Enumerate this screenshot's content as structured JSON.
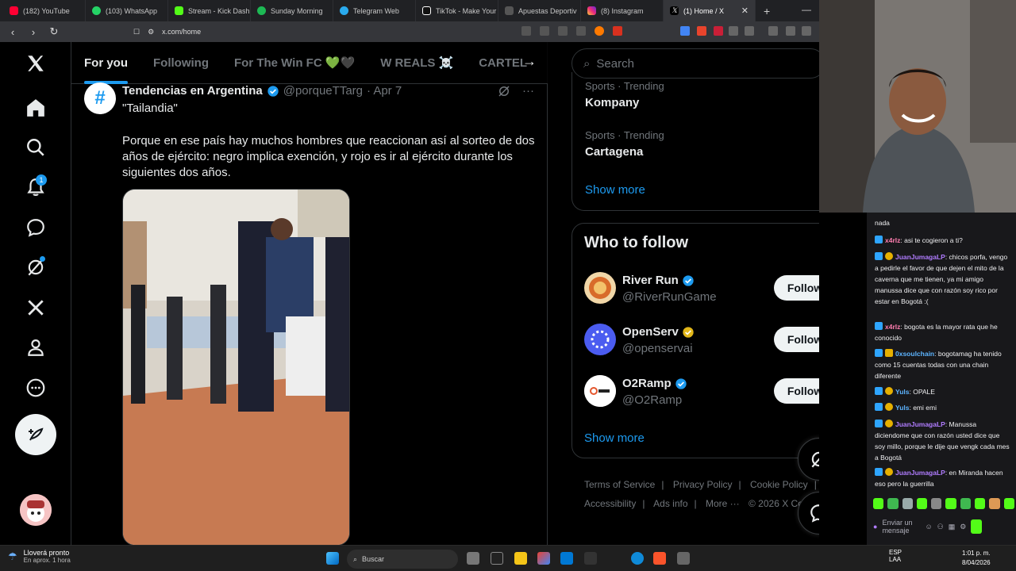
{
  "browser": {
    "tabs": [
      {
        "label": "(182) YouTube",
        "color": "#ff0033"
      },
      {
        "label": "(103) WhatsApp",
        "color": "#25d366"
      },
      {
        "label": "Stream - Kick Dashb",
        "color": "#53fc18"
      },
      {
        "label": "Sunday Morning",
        "color": "#1db954"
      },
      {
        "label": "Telegram Web",
        "color": "#2aabee"
      },
      {
        "label": "TikTok - Make Your",
        "color": "#ffffff"
      },
      {
        "label": "Apuestas Deportiv",
        "color": "#dddddd"
      },
      {
        "label": "(8) Instagram",
        "color": "#e1306c"
      },
      {
        "label": "(1) Home / X",
        "color": "#ffffff"
      }
    ],
    "url": "x.com/home"
  },
  "x": {
    "top_tabs": [
      "For you",
      "Following",
      "For The Win FC 💚🖤",
      "W REALS ☠️",
      "CARTEL"
    ],
    "notifications_badge": "1",
    "tweet": {
      "name": "Tendencias en Argentina",
      "handle": "@porqueTTarg",
      "date": "· Apr 7",
      "subtitle": "\"Tailandia\"",
      "text": "Porque en ese país hay muchos hombres que reaccionan así al sorteo de dos años de ejército: negro implica exención, y rojo es ir al ejército durante los siguientes dos años."
    },
    "search_placeholder": "Search",
    "trends": [
      {
        "category": "Sports · Trending",
        "name": "Kompany"
      },
      {
        "category": "Sports · Trending",
        "name": "Cartagena"
      }
    ],
    "show_more": "Show more",
    "who_to_follow_title": "Who to follow",
    "follow_suggestions": [
      {
        "name": "River Run",
        "handle": "@RiverRunGame",
        "badge_color": "#1d9bf0"
      },
      {
        "name": "OpenServ",
        "handle": "@openservai",
        "badge_color": "#e2b719"
      },
      {
        "name": "O2Ramp",
        "handle": "@O2Ramp",
        "badge_color": "#1d9bf0"
      }
    ],
    "follow_label": "Follow",
    "show_more_2": "Show more",
    "footer_links": [
      "Terms of Service",
      "|",
      "Privacy Policy",
      "|",
      "Cookie Policy",
      "|",
      "Accessibility",
      "|",
      "Ads info",
      "|",
      "More ···",
      "© 2026 X Co"
    ]
  },
  "chat": {
    "messages": [
      {
        "user": "",
        "text": "nada",
        "color": "#efeff1"
      },
      {
        "user": "x4rlz",
        "text": ": asi te cogieron a ti?",
        "color": "#ff7eb0"
      },
      {
        "user": "JuanJumagaLP",
        "text": ": chicos porfa, vengo a pedirle el favor de que dejen el mito de la caverna que me tienen, ya mi amigo manussa dice que con razón soy rico por estar en Bogotá :(",
        "color": "#b07cff"
      },
      {
        "user": "x4rlz",
        "text": ": bogota es la mayor rata que he conocido",
        "color": "#ff7eb0"
      },
      {
        "user": "0xsoulchain",
        "text": ": bogotamag ha tenido como 15 cuentas todas con una chain diferente",
        "color": "#5db4ff"
      },
      {
        "user": "Yuls",
        "text": ": OPALE",
        "color": "#5db4ff"
      },
      {
        "user": "Yuls",
        "text": ": emi emi",
        "color": "#5db4ff"
      },
      {
        "user": "JuanJumagaLP",
        "text": ": Manussa diciendome que con razón usted dice que soy millo, porque le dije que vengk cada mes a Bogotá",
        "color": "#b07cff"
      },
      {
        "user": "JuanJumagaLP",
        "text": ": en Miranda hacen eso pero la guerrilla",
        "color": "#b07cff"
      }
    ],
    "input_placeholder": "Enviar un mensaje"
  },
  "taskbar": {
    "weather_title": "Lloverá pronto",
    "weather_sub": "En aprox. 1 hora",
    "search_placeholder": "Buscar",
    "lang": "ESP",
    "lang2": "LAA",
    "time": "1:01 p. m.",
    "date": "8/04/2026"
  }
}
